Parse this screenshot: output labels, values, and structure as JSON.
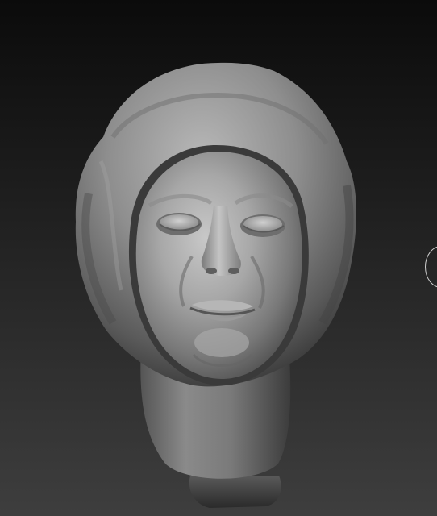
{
  "viewport": {
    "label": "",
    "background_top": "#0b0b0b",
    "background_bottom": "#3e3e3e"
  },
  "model": {
    "type": "sculpted-head-mesh",
    "material_color": "#9a9a9a"
  },
  "controls": {
    "side_handle_icon": "circle-handle-icon"
  }
}
